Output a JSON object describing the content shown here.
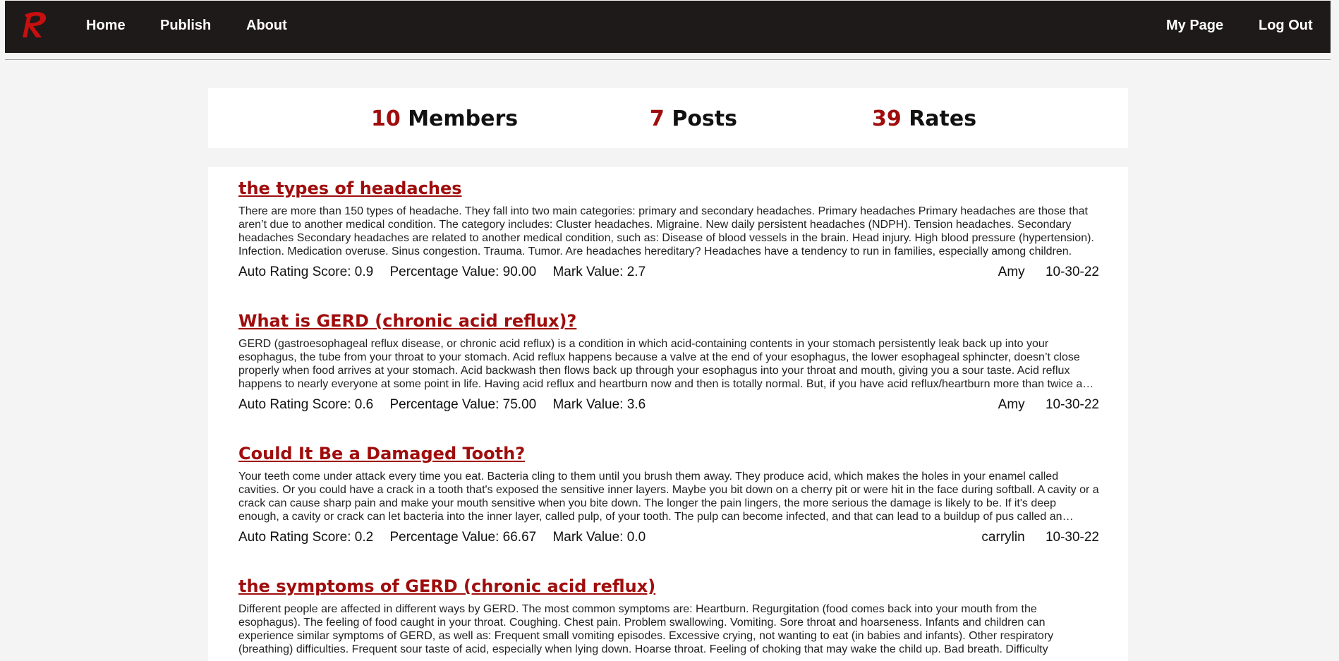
{
  "nav": {
    "logo_letter": "R",
    "home": "Home",
    "publish": "Publish",
    "about": "About",
    "my_page": "My Page",
    "log_out": "Log Out"
  },
  "stats": {
    "members_count": "10",
    "members_label": "Members",
    "posts_count": "7",
    "posts_label": "Posts",
    "rates_count": "39",
    "rates_label": "Rates"
  },
  "posts": [
    {
      "title": "the types of headaches",
      "body": "There are more than 150 types of headache. They fall into two main categories: primary and secondary headaches. Primary headaches Primary headaches are those that aren’t due to another medical condition. The category includes: Cluster headaches. Migraine. New daily persistent headaches (NDPH). Tension headaches. Secondary headaches Secondary headaches are related to another medical condition, such as: Disease of blood vessels in the brain. Head injury. High blood pressure (hypertension). Infection. Medication overuse. Sinus congestion. Trauma. Tumor. Are headaches hereditary? Headaches have a tendency to run in families, especially among children.",
      "auto_rating": "Auto Rating Score: 0.9",
      "percentage": "Percentage Value: 90.00",
      "mark": "Mark Value: 2.7",
      "author": "Amy",
      "date": "10-30-22"
    },
    {
      "title": "What is GERD (chronic acid reflux)?",
      "body": "GERD (gastroesophageal reflux disease, or chronic acid reflux) is a condition in which acid-containing contents in your stomach persistently leak back up into your esophagus, the tube from your throat to your stomach. Acid reflux happens because a valve at the end of your esophagus, the lower esophageal sphincter, doesn’t close properly when food arrives at your stomach. Acid backwash then flows back up through your esophagus into your throat and mouth, giving you a sour taste. Acid reflux happens to nearly everyone at some point in life. Having acid reflux and heartburn now and then is totally normal. But, if you have acid reflux/heartburn more than twice a week, you may have GERD.",
      "auto_rating": "Auto Rating Score: 0.6",
      "percentage": "Percentage Value: 75.00",
      "mark": "Mark Value: 3.6",
      "author": "Amy",
      "date": "10-30-22"
    },
    {
      "title": "Could It Be a Damaged Tooth?",
      "body": "Your teeth come under attack every time you eat. Bacteria cling to them until you brush them away. They produce acid, which makes the holes in your enamel called cavities. Or you could have a crack in a tooth that's exposed the sensitive inner layers. Maybe you bit down on a cherry pit or were hit in the face during softball. A cavity or a crack can cause sharp pain and make your mouth sensitive when you bite down. The longer the pain lingers, the more serious the damage is likely to be. If it's deep enough, a cavity or crack can let bacteria into the inner layer, called pulp, of your tooth. The pulp can become infected, and that can lead to a buildup of pus called an abscess.",
      "auto_rating": "Auto Rating Score: 0.2",
      "percentage": "Percentage Value: 66.67",
      "mark": "Mark Value: 0.0",
      "author": "carrylin",
      "date": "10-30-22"
    },
    {
      "title": "the symptoms of GERD (chronic acid reflux)",
      "body": "Different people are affected in different ways by GERD. The most common symptoms are: Heartburn. Regurgitation (food comes back into your mouth from the esophagus). The feeling of food caught in your throat. Coughing. Chest pain. Problem swallowing. Vomiting. Sore throat and hoarseness. Infants and children can experience similar symptoms of GERD, as well as: Frequent small vomiting episodes. Excessive crying, not wanting to eat (in babies and infants). Other respiratory (breathing) difficulties. Frequent sour taste of acid, especially when lying down. Hoarse throat. Feeling of choking that may wake the child up. Bad breath. Difficulty",
      "auto_rating": "",
      "percentage": "",
      "mark": "",
      "author": "",
      "date": ""
    }
  ],
  "colors": {
    "accent": "#a00d0d",
    "navbar_bg": "#1e1a19",
    "page_bg": "#f4f4f4"
  }
}
